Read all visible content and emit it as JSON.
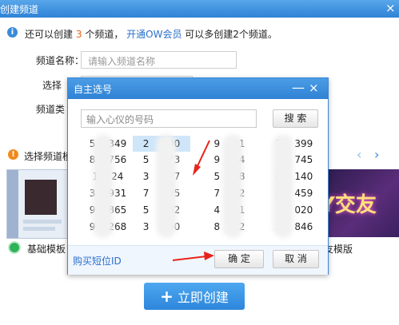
{
  "window": {
    "title": "创建频道",
    "close": "×"
  },
  "info": {
    "prefix": "还可以创建",
    "count": "3",
    "suffix": "个频道，",
    "link": "开通OW会员",
    "tail": "可以多创建2个频道。"
  },
  "form": {
    "name_label": "频道名称：",
    "name_placeholder": "请输入频道名称",
    "select_label": "选择",
    "type_label": "频道类"
  },
  "templates": {
    "section_label": "选择频道模",
    "basic_label": "基础模板",
    "dating_label": "友模版",
    "dating_logo": "Y交友"
  },
  "create_button": {
    "icon": "+",
    "label": "立即创建"
  },
  "modal": {
    "title": "自主选号",
    "minimize": "—",
    "close": "×",
    "input_placeholder": "输入心仪的号码",
    "search_label": "搜 索",
    "numbers": [
      [
        "5",
        "349",
        "2",
        "190",
        "9",
        "61",
        "7",
        "399"
      ],
      [
        "8",
        "756",
        "5",
        "673",
        "9",
        "44",
        "1",
        "745"
      ],
      [
        "1",
        "24",
        "3",
        "277",
        "5",
        "48",
        "6",
        "140"
      ],
      [
        "3",
        "931",
        "7",
        "195",
        "7",
        "02",
        "8",
        "459"
      ],
      [
        "9",
        "865",
        "5",
        "082",
        "4",
        "91",
        "7",
        "020"
      ],
      [
        "9",
        "268",
        "3",
        "190",
        "8",
        "12",
        "3",
        "846"
      ]
    ],
    "selected": {
      "row": 0,
      "col": 1
    },
    "buy_link": "购买短位ID",
    "ok_label": "确 定",
    "cancel_label": "取 消"
  },
  "colors": {
    "accent": "#2f83d6",
    "annotation": "#e8231c",
    "count": "#e8631a"
  }
}
